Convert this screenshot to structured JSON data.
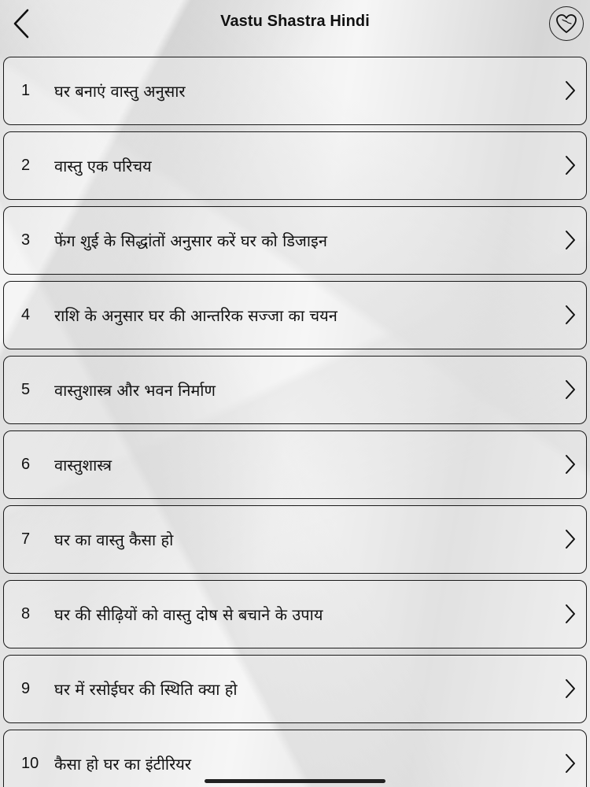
{
  "header": {
    "title": "Vastu Shastra Hindi",
    "back_icon": "chevron-left-icon",
    "favorite_icon": "heart-icon"
  },
  "items": [
    {
      "number": "1",
      "label": "घर बनाएं वास्तु अनुसार"
    },
    {
      "number": "2",
      "label": "वास्तु एक परिचय"
    },
    {
      "number": "3",
      "label": "फेंग शुई के सिद्धांतों अनुसार करें घर को डिजाइन"
    },
    {
      "number": "4",
      "label": "राशि के अनुसार घर की आन्तरिक सज्जा का चयन"
    },
    {
      "number": "5",
      "label": "वास्तुशास्त्र और भवन निर्माण"
    },
    {
      "number": "6",
      "label": "वास्तुशास्त्र"
    },
    {
      "number": "7",
      "label": "घर का वास्तु कैसा हो"
    },
    {
      "number": "8",
      "label": "घर की सीढ़ियों को वास्तु दोष से बचाने के उपाय"
    },
    {
      "number": "9",
      "label": "घर में रसोईघर की स्थिति क्या हो"
    },
    {
      "number": "10",
      "label": "कैसा हो घर का इंटीरियर"
    }
  ],
  "colors": {
    "text": "#111111",
    "border": "#1a1a1a",
    "background": "#e6e6e6"
  }
}
